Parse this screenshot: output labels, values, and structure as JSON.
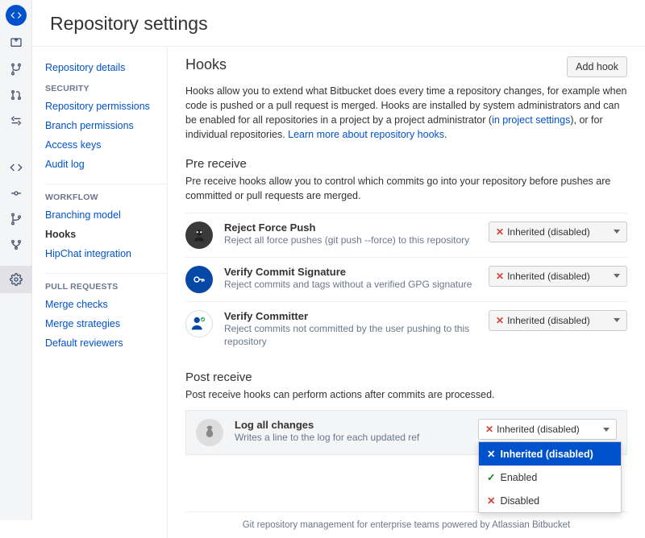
{
  "page": {
    "title": "Repository settings"
  },
  "sidebar": {
    "details": "Repository details",
    "sec_label": "SECURITY",
    "security": [
      "Repository permissions",
      "Branch permissions",
      "Access keys",
      "Audit log"
    ],
    "wf_label": "WORKFLOW",
    "workflow": [
      "Branching model",
      "Hooks",
      "HipChat integration"
    ],
    "pr_label": "PULL REQUESTS",
    "pullrequests": [
      "Merge checks",
      "Merge strategies",
      "Default reviewers"
    ]
  },
  "panel": {
    "heading": "Hooks",
    "add_btn": "Add hook",
    "desc1": "Hooks allow you to extend what Bitbucket does every time a repository changes, for example when code is pushed or a pull request is merged. Hooks are installed by system administrators and can be enabled for all repositories in a project by a project administrator (",
    "desc_link1": "in project settings",
    "desc2": "), or for individual repositories. ",
    "desc_link2": "Learn more about repository hooks",
    "desc3": "."
  },
  "pre": {
    "heading": "Pre receive",
    "desc": "Pre receive hooks allow you to control which commits go into your repository before pushes are committed or pull requests are merged.",
    "hooks": [
      {
        "title": "Reject Force Push",
        "sub": "Reject all force pushes (git push --force) to this repository",
        "status": "Inherited (disabled)"
      },
      {
        "title": "Verify Commit Signature",
        "sub": "Reject commits and tags without a verified GPG signature",
        "status": "Inherited (disabled)"
      },
      {
        "title": "Verify Committer",
        "sub": "Reject commits not committed by the user pushing to this repository",
        "status": "Inherited (disabled)"
      }
    ]
  },
  "post": {
    "heading": "Post receive",
    "desc": "Post receive hooks can perform actions after commits are processed.",
    "hook": {
      "title": "Log all changes",
      "sub": "Writes a line to the log for each updated ref",
      "status": "Inherited (disabled)"
    }
  },
  "dropdown": {
    "opt1": "Inherited (disabled)",
    "opt2": "Enabled",
    "opt3": "Disabled"
  },
  "footer": "Git repository management for enterprise teams powered by Atlassian Bitbucket"
}
